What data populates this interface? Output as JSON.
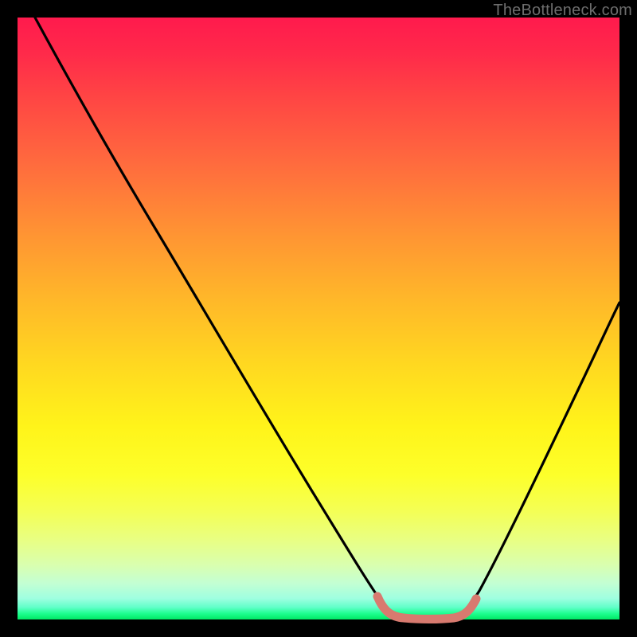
{
  "watermark": "TheBottleneck.com",
  "chart_data": {
    "type": "line",
    "title": "",
    "xlabel": "",
    "ylabel": "",
    "xlim": [
      0,
      100
    ],
    "ylim": [
      0,
      100
    ],
    "grid": false,
    "series": [
      {
        "name": "curve",
        "x": [
          3,
          10,
          20,
          30,
          40,
          50,
          56,
          59,
          62,
          66,
          70,
          73,
          80,
          90,
          99
        ],
        "values": [
          100,
          90,
          76,
          62,
          47,
          31,
          18,
          8,
          1,
          0,
          0,
          1,
          10,
          30,
          52
        ]
      }
    ],
    "highlight": {
      "name": "flat-bottom",
      "color": "#d87a6f",
      "x": [
        59,
        62,
        66,
        70,
        73
      ],
      "values": [
        2.2,
        0.4,
        0,
        0.4,
        2.2
      ]
    },
    "colors": {
      "curve_stroke": "#000000",
      "highlight_stroke": "#d87a6f",
      "background_top": "#ff1a4d",
      "background_bottom": "#00e865"
    }
  }
}
